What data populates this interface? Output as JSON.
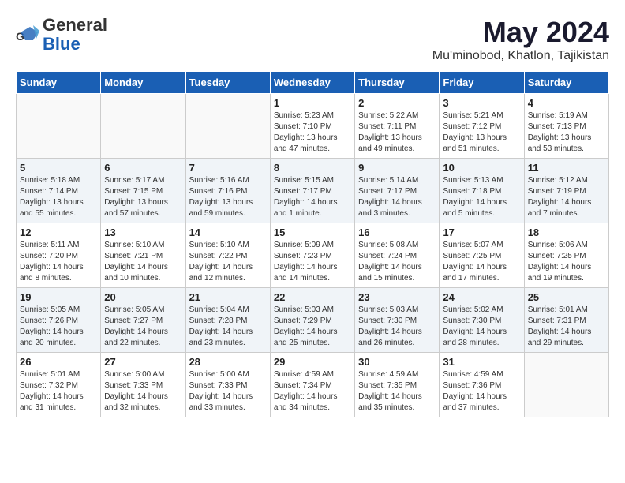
{
  "header": {
    "logo_general": "General",
    "logo_blue": "Blue",
    "month_title": "May 2024",
    "location": "Mu'minobod, Khatlon, Tajikistan"
  },
  "days_of_week": [
    "Sunday",
    "Monday",
    "Tuesday",
    "Wednesday",
    "Thursday",
    "Friday",
    "Saturday"
  ],
  "weeks": [
    [
      {
        "day": "",
        "sunrise": "",
        "sunset": "",
        "daylight": ""
      },
      {
        "day": "",
        "sunrise": "",
        "sunset": "",
        "daylight": ""
      },
      {
        "day": "",
        "sunrise": "",
        "sunset": "",
        "daylight": ""
      },
      {
        "day": "1",
        "sunrise": "Sunrise: 5:23 AM",
        "sunset": "Sunset: 7:10 PM",
        "daylight": "Daylight: 13 hours and 47 minutes."
      },
      {
        "day": "2",
        "sunrise": "Sunrise: 5:22 AM",
        "sunset": "Sunset: 7:11 PM",
        "daylight": "Daylight: 13 hours and 49 minutes."
      },
      {
        "day": "3",
        "sunrise": "Sunrise: 5:21 AM",
        "sunset": "Sunset: 7:12 PM",
        "daylight": "Daylight: 13 hours and 51 minutes."
      },
      {
        "day": "4",
        "sunrise": "Sunrise: 5:19 AM",
        "sunset": "Sunset: 7:13 PM",
        "daylight": "Daylight: 13 hours and 53 minutes."
      }
    ],
    [
      {
        "day": "5",
        "sunrise": "Sunrise: 5:18 AM",
        "sunset": "Sunset: 7:14 PM",
        "daylight": "Daylight: 13 hours and 55 minutes."
      },
      {
        "day": "6",
        "sunrise": "Sunrise: 5:17 AM",
        "sunset": "Sunset: 7:15 PM",
        "daylight": "Daylight: 13 hours and 57 minutes."
      },
      {
        "day": "7",
        "sunrise": "Sunrise: 5:16 AM",
        "sunset": "Sunset: 7:16 PM",
        "daylight": "Daylight: 13 hours and 59 minutes."
      },
      {
        "day": "8",
        "sunrise": "Sunrise: 5:15 AM",
        "sunset": "Sunset: 7:17 PM",
        "daylight": "Daylight: 14 hours and 1 minute."
      },
      {
        "day": "9",
        "sunrise": "Sunrise: 5:14 AM",
        "sunset": "Sunset: 7:17 PM",
        "daylight": "Daylight: 14 hours and 3 minutes."
      },
      {
        "day": "10",
        "sunrise": "Sunrise: 5:13 AM",
        "sunset": "Sunset: 7:18 PM",
        "daylight": "Daylight: 14 hours and 5 minutes."
      },
      {
        "day": "11",
        "sunrise": "Sunrise: 5:12 AM",
        "sunset": "Sunset: 7:19 PM",
        "daylight": "Daylight: 14 hours and 7 minutes."
      }
    ],
    [
      {
        "day": "12",
        "sunrise": "Sunrise: 5:11 AM",
        "sunset": "Sunset: 7:20 PM",
        "daylight": "Daylight: 14 hours and 8 minutes."
      },
      {
        "day": "13",
        "sunrise": "Sunrise: 5:10 AM",
        "sunset": "Sunset: 7:21 PM",
        "daylight": "Daylight: 14 hours and 10 minutes."
      },
      {
        "day": "14",
        "sunrise": "Sunrise: 5:10 AM",
        "sunset": "Sunset: 7:22 PM",
        "daylight": "Daylight: 14 hours and 12 minutes."
      },
      {
        "day": "15",
        "sunrise": "Sunrise: 5:09 AM",
        "sunset": "Sunset: 7:23 PM",
        "daylight": "Daylight: 14 hours and 14 minutes."
      },
      {
        "day": "16",
        "sunrise": "Sunrise: 5:08 AM",
        "sunset": "Sunset: 7:24 PM",
        "daylight": "Daylight: 14 hours and 15 minutes."
      },
      {
        "day": "17",
        "sunrise": "Sunrise: 5:07 AM",
        "sunset": "Sunset: 7:25 PM",
        "daylight": "Daylight: 14 hours and 17 minutes."
      },
      {
        "day": "18",
        "sunrise": "Sunrise: 5:06 AM",
        "sunset": "Sunset: 7:25 PM",
        "daylight": "Daylight: 14 hours and 19 minutes."
      }
    ],
    [
      {
        "day": "19",
        "sunrise": "Sunrise: 5:05 AM",
        "sunset": "Sunset: 7:26 PM",
        "daylight": "Daylight: 14 hours and 20 minutes."
      },
      {
        "day": "20",
        "sunrise": "Sunrise: 5:05 AM",
        "sunset": "Sunset: 7:27 PM",
        "daylight": "Daylight: 14 hours and 22 minutes."
      },
      {
        "day": "21",
        "sunrise": "Sunrise: 5:04 AM",
        "sunset": "Sunset: 7:28 PM",
        "daylight": "Daylight: 14 hours and 23 minutes."
      },
      {
        "day": "22",
        "sunrise": "Sunrise: 5:03 AM",
        "sunset": "Sunset: 7:29 PM",
        "daylight": "Daylight: 14 hours and 25 minutes."
      },
      {
        "day": "23",
        "sunrise": "Sunrise: 5:03 AM",
        "sunset": "Sunset: 7:30 PM",
        "daylight": "Daylight: 14 hours and 26 minutes."
      },
      {
        "day": "24",
        "sunrise": "Sunrise: 5:02 AM",
        "sunset": "Sunset: 7:30 PM",
        "daylight": "Daylight: 14 hours and 28 minutes."
      },
      {
        "day": "25",
        "sunrise": "Sunrise: 5:01 AM",
        "sunset": "Sunset: 7:31 PM",
        "daylight": "Daylight: 14 hours and 29 minutes."
      }
    ],
    [
      {
        "day": "26",
        "sunrise": "Sunrise: 5:01 AM",
        "sunset": "Sunset: 7:32 PM",
        "daylight": "Daylight: 14 hours and 31 minutes."
      },
      {
        "day": "27",
        "sunrise": "Sunrise: 5:00 AM",
        "sunset": "Sunset: 7:33 PM",
        "daylight": "Daylight: 14 hours and 32 minutes."
      },
      {
        "day": "28",
        "sunrise": "Sunrise: 5:00 AM",
        "sunset": "Sunset: 7:33 PM",
        "daylight": "Daylight: 14 hours and 33 minutes."
      },
      {
        "day": "29",
        "sunrise": "Sunrise: 4:59 AM",
        "sunset": "Sunset: 7:34 PM",
        "daylight": "Daylight: 14 hours and 34 minutes."
      },
      {
        "day": "30",
        "sunrise": "Sunrise: 4:59 AM",
        "sunset": "Sunset: 7:35 PM",
        "daylight": "Daylight: 14 hours and 35 minutes."
      },
      {
        "day": "31",
        "sunrise": "Sunrise: 4:59 AM",
        "sunset": "Sunset: 7:36 PM",
        "daylight": "Daylight: 14 hours and 37 minutes."
      },
      {
        "day": "",
        "sunrise": "",
        "sunset": "",
        "daylight": ""
      }
    ]
  ]
}
